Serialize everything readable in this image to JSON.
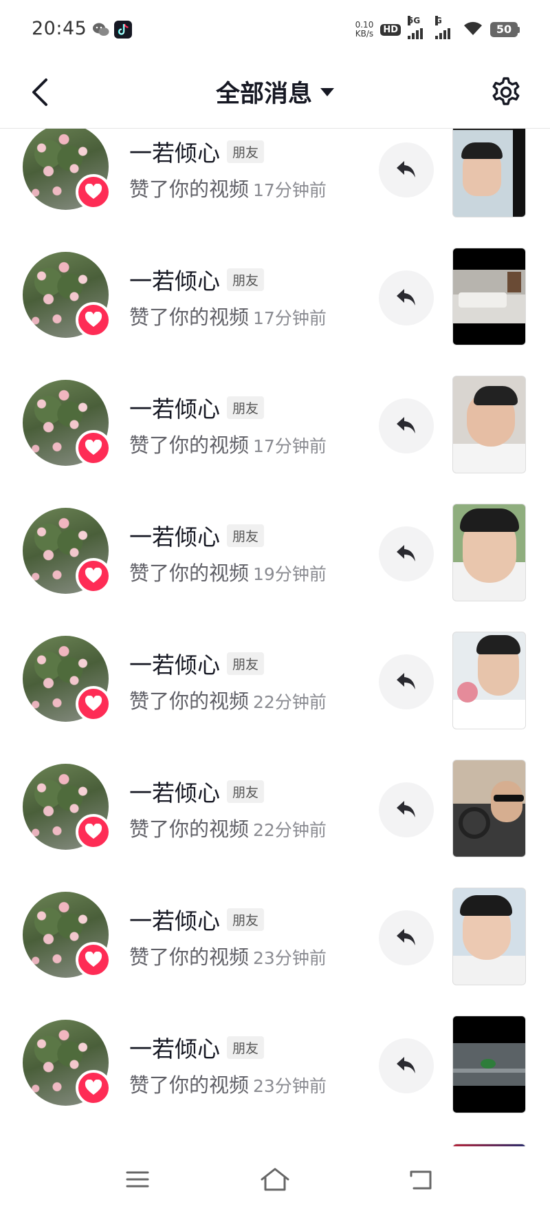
{
  "status_bar": {
    "time": "20:45",
    "network_speed_value": "0.10",
    "network_speed_unit": "KB/s",
    "hd_label": "HD",
    "sim1_label": "5G",
    "sim2_label": "G",
    "battery_level": "50",
    "app_icons": [
      "wechat-icon",
      "douyin-icon"
    ]
  },
  "header": {
    "title": "全部消息",
    "back_icon": "chevron-left-icon",
    "settings_icon": "gear-icon"
  },
  "notifications": [
    {
      "name": "一若倾心",
      "tag": "朋友",
      "action": "赞了你的视频",
      "time": "17分钟前"
    },
    {
      "name": "一若倾心",
      "tag": "朋友",
      "action": "赞了你的视频",
      "time": "17分钟前"
    },
    {
      "name": "一若倾心",
      "tag": "朋友",
      "action": "赞了你的视频",
      "time": "17分钟前"
    },
    {
      "name": "一若倾心",
      "tag": "朋友",
      "action": "赞了你的视频",
      "time": "19分钟前"
    },
    {
      "name": "一若倾心",
      "tag": "朋友",
      "action": "赞了你的视频",
      "time": "22分钟前"
    },
    {
      "name": "一若倾心",
      "tag": "朋友",
      "action": "赞了你的视频",
      "time": "22分钟前"
    },
    {
      "name": "一若倾心",
      "tag": "朋友",
      "action": "赞了你的视频",
      "time": "23分钟前"
    },
    {
      "name": "一若倾心",
      "tag": "朋友",
      "action": "赞了你的视频",
      "time": "23分钟前"
    }
  ],
  "bottom_nav": {
    "menu_icon": "menu-icon",
    "home_icon": "home-icon",
    "back_icon": "back-icon"
  },
  "colors": {
    "accent": "#fe2c55",
    "text_primary": "#161823",
    "text_secondary": "#5f5f66",
    "text_tertiary": "#8a8b91",
    "reply_bg": "#f3f3f4"
  }
}
